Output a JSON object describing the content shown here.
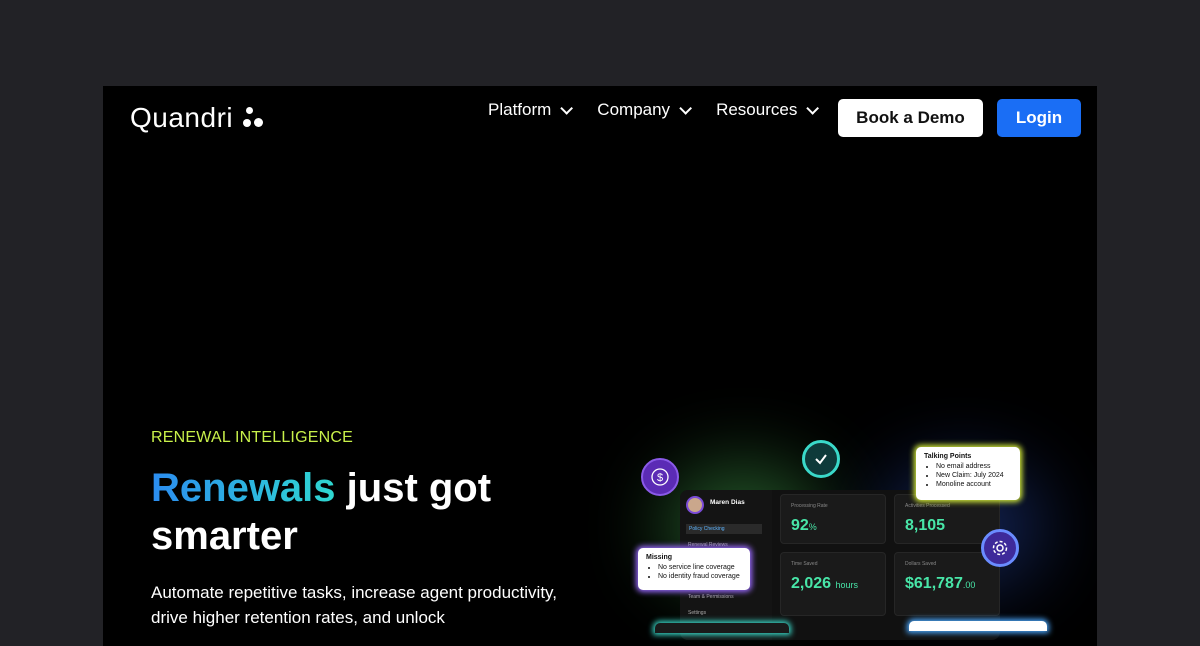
{
  "brand": {
    "name": "Quandri"
  },
  "nav": {
    "items": [
      {
        "label": "Platform"
      },
      {
        "label": "Company"
      },
      {
        "label": "Resources"
      }
    ],
    "demo_label": "Book a Demo",
    "login_label": "Login"
  },
  "hero": {
    "eyebrow": "RENEWAL INTELLIGENCE",
    "headline_gradient": "Renewals",
    "headline_rest": " just got",
    "headline_line2": "smarter",
    "subtext": "Automate repetitive tasks, increase agent productivity, drive higher retention rates, and unlock"
  },
  "dashboard": {
    "user_name": "Maren Dias",
    "sidebar": [
      "Policy Checking",
      "Renewal Reviews",
      "Team & Permissions",
      "Settings"
    ],
    "stats": [
      {
        "label": "Processing Rate",
        "value": "92",
        "unit": "%"
      },
      {
        "label": "Activities Processed",
        "value": "8,105",
        "unit": ""
      },
      {
        "label": "Time Saved",
        "value": "2,026",
        "unit": "hours"
      },
      {
        "label": "Dollars Saved",
        "value": "$61,787",
        "unit": ".00"
      }
    ]
  },
  "talking_points": {
    "title": "Talking Points",
    "items": [
      "No email address",
      "New Claim: July 2024",
      "Monoline account"
    ]
  },
  "missing": {
    "title": "Missing",
    "items": [
      "No service line coverage",
      "No identity fraud coverage"
    ]
  },
  "colors": {
    "accent_blue": "#1a6ef5",
    "eyebrow_green": "#c8f04a",
    "stat_green": "#48e6a8"
  }
}
